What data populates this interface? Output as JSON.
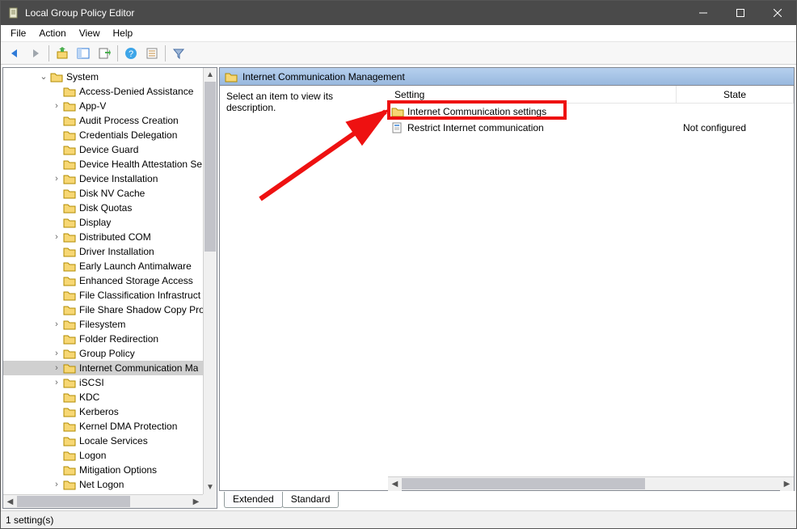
{
  "window": {
    "title": "Local Group Policy Editor"
  },
  "menubar": [
    "File",
    "Action",
    "View",
    "Help"
  ],
  "tree": {
    "root": "System",
    "items": [
      {
        "label": "Access-Denied Assistance",
        "exp": ""
      },
      {
        "label": "App-V",
        "exp": ">"
      },
      {
        "label": "Audit Process Creation",
        "exp": ""
      },
      {
        "label": "Credentials Delegation",
        "exp": ""
      },
      {
        "label": "Device Guard",
        "exp": ""
      },
      {
        "label": "Device Health Attestation Se",
        "exp": ""
      },
      {
        "label": "Device Installation",
        "exp": ">"
      },
      {
        "label": "Disk NV Cache",
        "exp": ""
      },
      {
        "label": "Disk Quotas",
        "exp": ""
      },
      {
        "label": "Display",
        "exp": ""
      },
      {
        "label": "Distributed COM",
        "exp": ">"
      },
      {
        "label": "Driver Installation",
        "exp": ""
      },
      {
        "label": "Early Launch Antimalware",
        "exp": ""
      },
      {
        "label": "Enhanced Storage Access",
        "exp": ""
      },
      {
        "label": "File Classification Infrastruct",
        "exp": ""
      },
      {
        "label": "File Share Shadow Copy Pro",
        "exp": ""
      },
      {
        "label": "Filesystem",
        "exp": ">"
      },
      {
        "label": "Folder Redirection",
        "exp": ""
      },
      {
        "label": "Group Policy",
        "exp": ">"
      },
      {
        "label": "Internet Communication Ma",
        "exp": ">",
        "selected": true
      },
      {
        "label": "iSCSI",
        "exp": ">"
      },
      {
        "label": "KDC",
        "exp": ""
      },
      {
        "label": "Kerberos",
        "exp": ""
      },
      {
        "label": "Kernel DMA Protection",
        "exp": ""
      },
      {
        "label": "Locale Services",
        "exp": ""
      },
      {
        "label": "Logon",
        "exp": ""
      },
      {
        "label": "Mitigation Options",
        "exp": ""
      },
      {
        "label": "Net Logon",
        "exp": ">"
      }
    ]
  },
  "right": {
    "header": "Internet Communication Management",
    "desc_prompt": "Select an item to view its description.",
    "columns": {
      "setting": "Setting",
      "state": "State"
    },
    "rows": [
      {
        "type": "folder",
        "setting": "Internet Communication settings",
        "state": ""
      },
      {
        "type": "policy",
        "setting": "Restrict Internet communication",
        "state": "Not configured"
      }
    ],
    "tabs": [
      "Extended",
      "Standard"
    ],
    "active_tab": 1
  },
  "statusbar": {
    "text": "1 setting(s)"
  }
}
